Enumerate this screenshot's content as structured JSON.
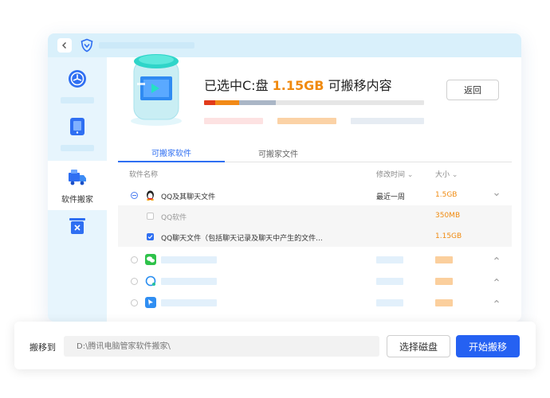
{
  "header": {
    "title_prefix": "已选中C:盘",
    "title_size": "1.15GB",
    "title_suffix": "可搬移内容",
    "return_label": "返回"
  },
  "sidebar": {
    "active_label": "软件搬家"
  },
  "tabs": [
    {
      "label": "可搬家软件"
    },
    {
      "label": "可搬家文件"
    }
  ],
  "table": {
    "columns": {
      "name": "软件名称",
      "modified": "修改时间",
      "size": "大小"
    },
    "group": {
      "name": "QQ及其聊天文件",
      "modified": "最近一周",
      "size": "1.5GB"
    },
    "children": [
      {
        "name": "QQ软件",
        "size": "350MB",
        "checked": false
      },
      {
        "name": "QQ聊天文件（包括聊天记录及聊天中产生的文件...",
        "size": "1.15GB",
        "checked": true
      }
    ]
  },
  "footer": {
    "move_to_label": "搬移到",
    "path_placeholder": "D:\\腾讯电脑管家软件搬家\\",
    "choose_disk_label": "选择磁盘",
    "start_label": "开始搬移"
  },
  "colors": {
    "accent": "#2f6ff2",
    "highlight": "#f08a0f",
    "start_button": "#2561f2"
  },
  "icons": [
    "back-arrow-icon",
    "shield-logo-icon",
    "fan-icon",
    "phone-icon",
    "truck-icon",
    "trash-icon",
    "qq-penguin-icon",
    "wechat-icon",
    "browser-icon",
    "feather-icon",
    "chevron-down-icon",
    "chevron-up-icon"
  ]
}
